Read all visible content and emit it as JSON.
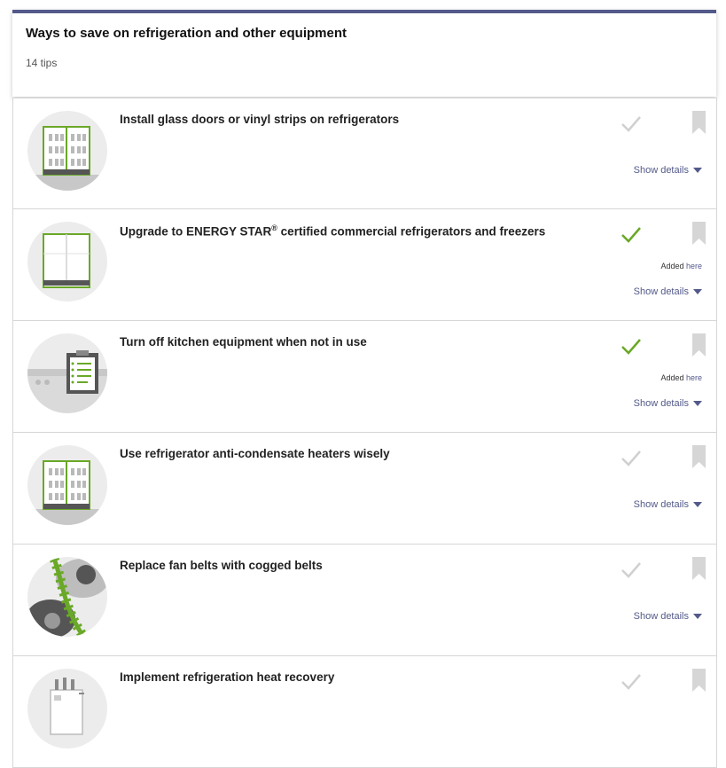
{
  "header": {
    "title": "Ways to save on refrigeration and other equipment",
    "count": "14 tips"
  },
  "colors": {
    "accent": "#535a8a",
    "green": "#6aa828",
    "check_inactive": "#d0d0d0"
  },
  "tips": [
    {
      "title": "Install glass doors or vinyl strips on refrigerators",
      "icon": "glass-door-fridge-icon",
      "added": false,
      "show_details": "Show details"
    },
    {
      "title_main": "Upgrade to ENERGY STAR",
      "title_sup": "®",
      "title_rest": " certified commercial refrigerators and freezers",
      "icon": "fridge-icon",
      "added": true,
      "added_label": "Added",
      "added_link": "here",
      "show_details": "Show details"
    },
    {
      "title": "Turn off kitchen equipment when not in use",
      "icon": "checklist-clipboard-icon",
      "added": true,
      "added_label": "Added",
      "added_link": "here",
      "show_details": "Show details"
    },
    {
      "title": "Use refrigerator anti-condensate heaters wisely",
      "icon": "glass-door-fridge-icon",
      "added": false,
      "show_details": "Show details"
    },
    {
      "title": "Replace fan belts with cogged belts",
      "icon": "cogged-belt-icon",
      "added": false,
      "show_details": "Show details"
    },
    {
      "title": "Implement refrigeration heat recovery",
      "icon": "heat-recovery-unit-icon",
      "added": false
    }
  ]
}
